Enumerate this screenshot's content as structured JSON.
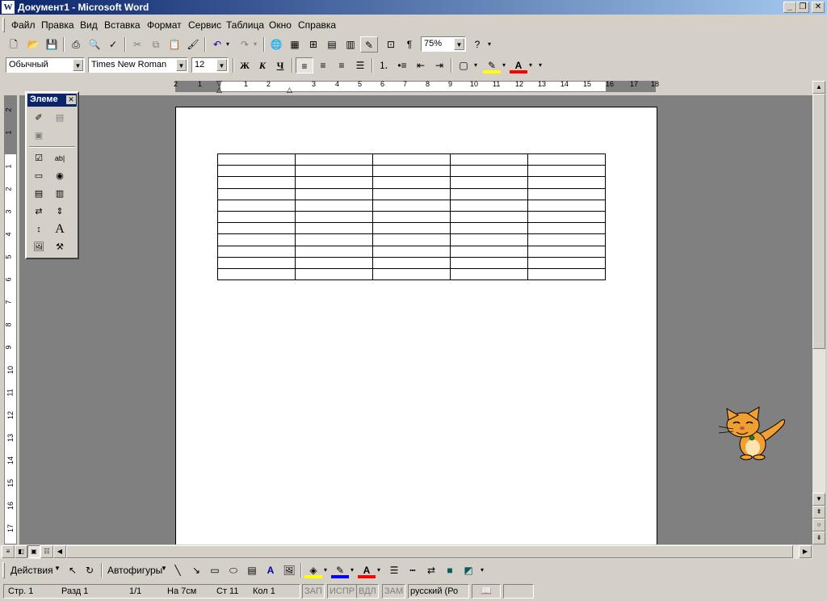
{
  "window": {
    "title": "Документ1 - Microsoft Word",
    "app_icon": "W",
    "minimize": "_",
    "restore": "❐",
    "close": "✕"
  },
  "menu": [
    "Файл",
    "Правка",
    "Вид",
    "Вставка",
    "Формат",
    "Сервис",
    "Таблица",
    "Окно",
    "Справка"
  ],
  "standard_toolbar": {
    "zoom": "75%"
  },
  "format_toolbar": {
    "style": "Обычный",
    "font": "Times New Roman",
    "size": "12",
    "bold": "Ж",
    "italic": "К",
    "underline": "Ч"
  },
  "ruler": {
    "h_ticks": [
      "2",
      "1",
      "1",
      "2",
      "3",
      "4",
      "5",
      "6",
      "7",
      "8",
      "9",
      "10",
      "11",
      "12",
      "13",
      "14",
      "15",
      "16",
      "17",
      "18"
    ],
    "v_ticks": [
      "2",
      "1",
      "1",
      "2",
      "3",
      "4",
      "5",
      "6",
      "7",
      "8",
      "9",
      "10",
      "11",
      "12",
      "13",
      "14",
      "15",
      "16",
      "17"
    ]
  },
  "toolbox": {
    "title": "Элеме",
    "close": "✕"
  },
  "document": {
    "table_rows": 11,
    "table_cols": 5
  },
  "draw_toolbar": {
    "actions": "Действия",
    "autoshapes": "Автофигуры"
  },
  "status": {
    "page": "Стр. 1",
    "section": "Разд 1",
    "pages": "1/1",
    "at": "На 7см",
    "line": "Ст 11",
    "col": "Кол 1",
    "rec": "ЗАП",
    "trk": "ИСПР",
    "ext": "ВДЛ",
    "ovr": "ЗАМ",
    "lang": "русский (Ро"
  },
  "colors": {
    "title_start": "#0a246a",
    "title_end": "#a6caf0",
    "face": "#d4d0c8",
    "workspace": "#808080",
    "highlight": "#ffff00",
    "font_color": "#ff0000"
  }
}
